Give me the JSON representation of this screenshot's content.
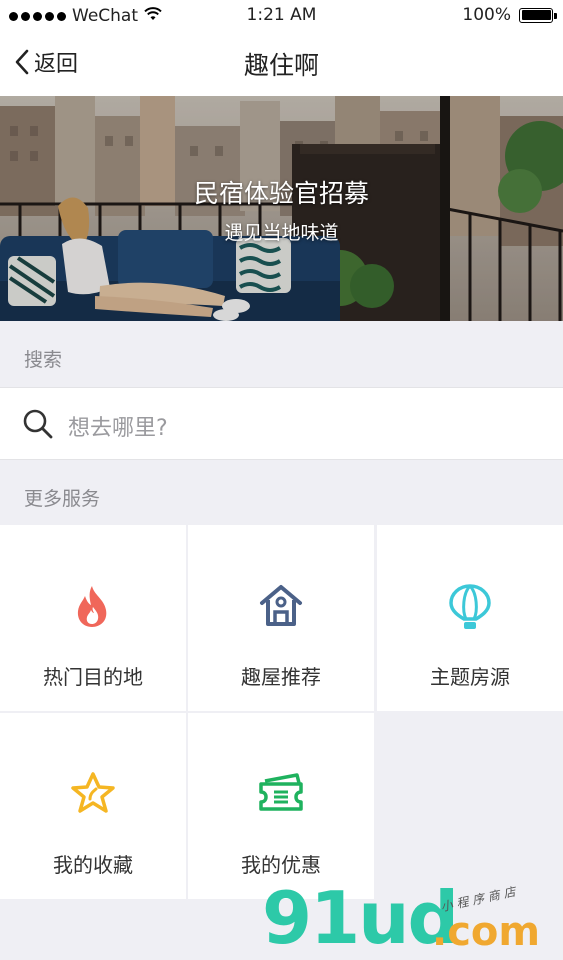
{
  "status_bar": {
    "carrier": "WeChat",
    "time": "1:21 AM",
    "battery": "100%"
  },
  "nav": {
    "back_label": "返回",
    "title": "趣住啊"
  },
  "banner": {
    "title": "民宿体验官招募",
    "subtitle": "遇见当地味道"
  },
  "search": {
    "section_label": "搜索",
    "placeholder": "想去哪里?"
  },
  "services": {
    "section_label": "更多服务",
    "items": [
      {
        "label": "热门目的地",
        "icon": "flame-icon",
        "color": "#f0675a"
      },
      {
        "label": "趣屋推荐",
        "icon": "house-icon",
        "color": "#4b6188"
      },
      {
        "label": "主题房源",
        "icon": "hot-air-balloon-icon",
        "color": "#3cc8d8"
      },
      {
        "label": "我的收藏",
        "icon": "star-icon",
        "color": "#f5b623"
      },
      {
        "label": "我的优惠",
        "icon": "ticket-icon",
        "color": "#1fb25e"
      }
    ]
  },
  "watermark": {
    "brand": "91ud",
    "tld": ".com",
    "tagline": "小程序商店"
  }
}
